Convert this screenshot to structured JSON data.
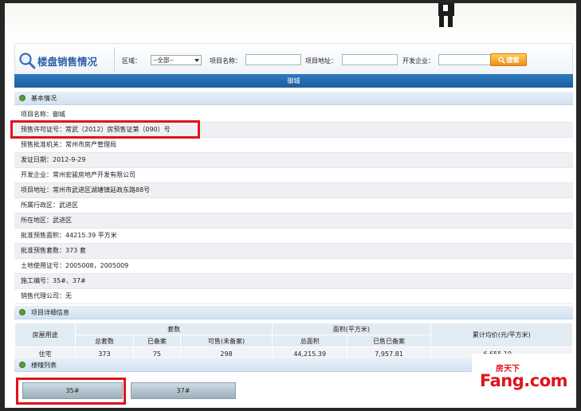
{
  "search": {
    "title": "楼盘销售情况",
    "district_label": "区域：",
    "district_value": "--全部--",
    "name_label": "项目名称：",
    "address_label": "项目地址：",
    "developer_label": "开发企业：",
    "search_label": "搜索"
  },
  "project_title": "御城",
  "basic": {
    "header": "基本情况",
    "rows": [
      {
        "label": "项目名称：",
        "value": "御城"
      },
      {
        "label": "预售许可证号：",
        "value": "常武（2012）房预售证第（090）号"
      },
      {
        "label": "预售批准机关：",
        "value": "常州市房产管理局"
      },
      {
        "label": "发证日期：",
        "value": "2012-9-29"
      },
      {
        "label": "开发企业：",
        "value": "常州宏骏房地产开发有限公司"
      },
      {
        "label": "项目地址：",
        "value": "常州市武进区湖塘镇延政东路88号"
      },
      {
        "label": "所属行政区：",
        "value": "武进区"
      },
      {
        "label": "所在地区：",
        "value": "武进区"
      },
      {
        "label": "批准预售面积：",
        "value": "44215.39 平方米"
      },
      {
        "label": "批准预售套数：",
        "value": "373 套"
      },
      {
        "label": "土地使用证号：",
        "value": "2005008，2005009"
      },
      {
        "label": "施工编号：",
        "value": "35#、37#"
      },
      {
        "label": "销售代理公司：",
        "value": "无"
      }
    ]
  },
  "detail": {
    "header": "项目详细信息",
    "usage_header": "房屋用途",
    "units_header": "套数",
    "area_header": "面积(平方米)",
    "avg_price_header": "累计均价(元/平方米)",
    "sub": [
      "总套数",
      "已备案",
      "可售(未备案)",
      "总面积",
      "已售已备案"
    ],
    "row": {
      "usage": "住宅",
      "total_units": "373",
      "filed_units": "75",
      "available_units": "298",
      "total_area": "44,215.39",
      "sold_area": "7,957.81",
      "avg_price": "6,655.19"
    }
  },
  "buildings": {
    "header": "楼幢列表",
    "items": [
      "35#",
      "37#"
    ]
  },
  "watermark": {
    "top": "房天下",
    "word": "Fang.com"
  },
  "colors": {
    "title_bar": "#1e5d9d",
    "highlight": "#e0141c",
    "search_button": "#f08c1a"
  }
}
